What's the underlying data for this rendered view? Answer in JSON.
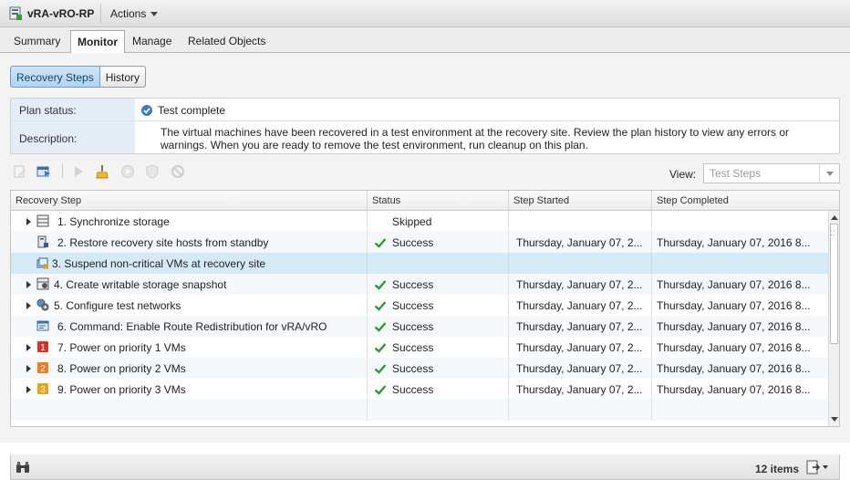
{
  "header": {
    "title": "vRA-vRO-RP",
    "actions_label": "Actions",
    "tabs": [
      {
        "label": "Summary",
        "active": false
      },
      {
        "label": "Monitor",
        "active": true
      },
      {
        "label": "Manage",
        "active": false
      },
      {
        "label": "Related Objects",
        "active": false
      }
    ]
  },
  "subtabs": [
    {
      "label": "Recovery Steps",
      "selected": true
    },
    {
      "label": "History",
      "selected": false
    }
  ],
  "plan": {
    "status_label": "Plan status:",
    "status_value": "Test complete",
    "description_label": "Description:",
    "description_value": "The virtual machines have been recovered in a test environment at the recovery site. Review the plan history to view any errors or warnings. When you are ready to remove the test environment, run cleanup on this plan."
  },
  "toolbar": {
    "icons": [
      "edit-plan-icon",
      "run-plan-icon",
      "run-icon",
      "cleanup-icon",
      "resume-icon",
      "reprotect-icon",
      "cancel-icon"
    ],
    "view_label": "View:",
    "view_value": "Test Steps"
  },
  "table": {
    "columns": [
      "Recovery Step",
      "Status",
      "Step Started",
      "Step Completed"
    ],
    "rows": [
      {
        "step": "1. Synchronize storage",
        "expandable": true,
        "icon": "storage-icon",
        "status": "Skipped",
        "success": false,
        "started": "",
        "completed": ""
      },
      {
        "step": "2. Restore recovery site hosts from standby",
        "expandable": false,
        "icon": "host-restore-icon",
        "status": "Success",
        "success": true,
        "started": "Thursday, January 07, 2...",
        "completed": "Thursday, January 07, 2016 8..."
      },
      {
        "step": "3. Suspend non-critical VMs at recovery site",
        "expandable": false,
        "icon": "suspend-vms-icon",
        "status": "",
        "success": false,
        "started": "",
        "completed": "",
        "selected": true
      },
      {
        "step": "4. Create writable storage snapshot",
        "expandable": true,
        "icon": "snapshot-icon",
        "status": "Success",
        "success": true,
        "started": "Thursday, January 07, 2...",
        "completed": "Thursday, January 07, 2016 8..."
      },
      {
        "step": "5. Configure test networks",
        "expandable": true,
        "icon": "network-gear-icon",
        "status": "Success",
        "success": true,
        "started": "Thursday, January 07, 2...",
        "completed": "Thursday, January 07, 2016 8..."
      },
      {
        "step": "6. Command: Enable Route Redistribution for vRA/vRO",
        "expandable": false,
        "icon": "command-icon",
        "status": "Success",
        "success": true,
        "started": "Thursday, January 07, 2...",
        "completed": "Thursday, January 07, 2016 8..."
      },
      {
        "step": "7. Power on priority 1 VMs",
        "expandable": true,
        "icon": "priority-1-icon",
        "badge": "1",
        "badge_color": "#d9322a",
        "status": "Success",
        "success": true,
        "started": "Thursday, January 07, 2...",
        "completed": "Thursday, January 07, 2016 8..."
      },
      {
        "step": "8. Power on priority 2 VMs",
        "expandable": true,
        "icon": "priority-2-icon",
        "badge": "2",
        "badge_color": "#ee7d22",
        "status": "Success",
        "success": true,
        "started": "Thursday, January 07, 2...",
        "completed": "Thursday, January 07, 2016 8..."
      },
      {
        "step": "9. Power on priority 3 VMs",
        "expandable": true,
        "icon": "priority-3-icon",
        "badge": "3",
        "badge_color": "#e8a31b",
        "status": "Success",
        "success": true,
        "started": "Thursday, January 07, 2...",
        "completed": "Thursday, January 07, 2016 8..."
      }
    ]
  },
  "footer": {
    "item_count": "12 items"
  },
  "colors": {
    "success": "#2c9a34",
    "accent": "#3d7cbf",
    "selected_row": "#d5eaf7"
  }
}
